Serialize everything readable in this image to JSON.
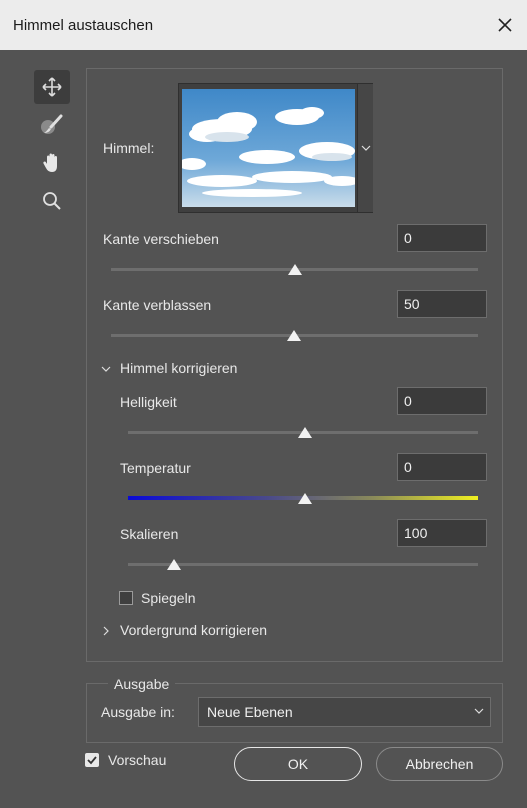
{
  "window": {
    "title": "Himmel austauschen"
  },
  "tools": [
    {
      "icon": "move-icon",
      "active": true
    },
    {
      "icon": "brush-icon",
      "active": false
    },
    {
      "icon": "hand-icon",
      "active": false
    },
    {
      "icon": "zoom-icon",
      "active": false
    }
  ],
  "sky": {
    "label": "Himmel:"
  },
  "edge_shift": {
    "label": "Kante verschieben",
    "value": "0",
    "slider_position": 0.5
  },
  "edge_fade": {
    "label": "Kante verblassen",
    "value": "50",
    "slider_position": 0.5
  },
  "sky_adjust": {
    "label": "Himmel korrigieren",
    "expanded": true,
    "brightness": {
      "label": "Helligkeit",
      "value": "0",
      "slider_position": 0.5
    },
    "temperature": {
      "label": "Temperatur",
      "value": "0",
      "slider_position": 0.5
    },
    "scale": {
      "label": "Skalieren",
      "value": "100",
      "slider_position": 0.13
    },
    "flip": {
      "label": "Spiegeln",
      "checked": false
    }
  },
  "foreground_adjust": {
    "label": "Vordergrund korrigieren",
    "expanded": false
  },
  "output": {
    "group_label": "Ausgabe",
    "output_to_label": "Ausgabe in:",
    "output_to_value": "Neue Ebenen"
  },
  "preview": {
    "label": "Vorschau",
    "checked": true
  },
  "buttons": {
    "ok": "OK",
    "cancel": "Abbrechen"
  },
  "colors": {
    "dialog_bg": "#535353",
    "titlebar_bg": "#ececec",
    "field_bg": "#3b3b3b"
  }
}
